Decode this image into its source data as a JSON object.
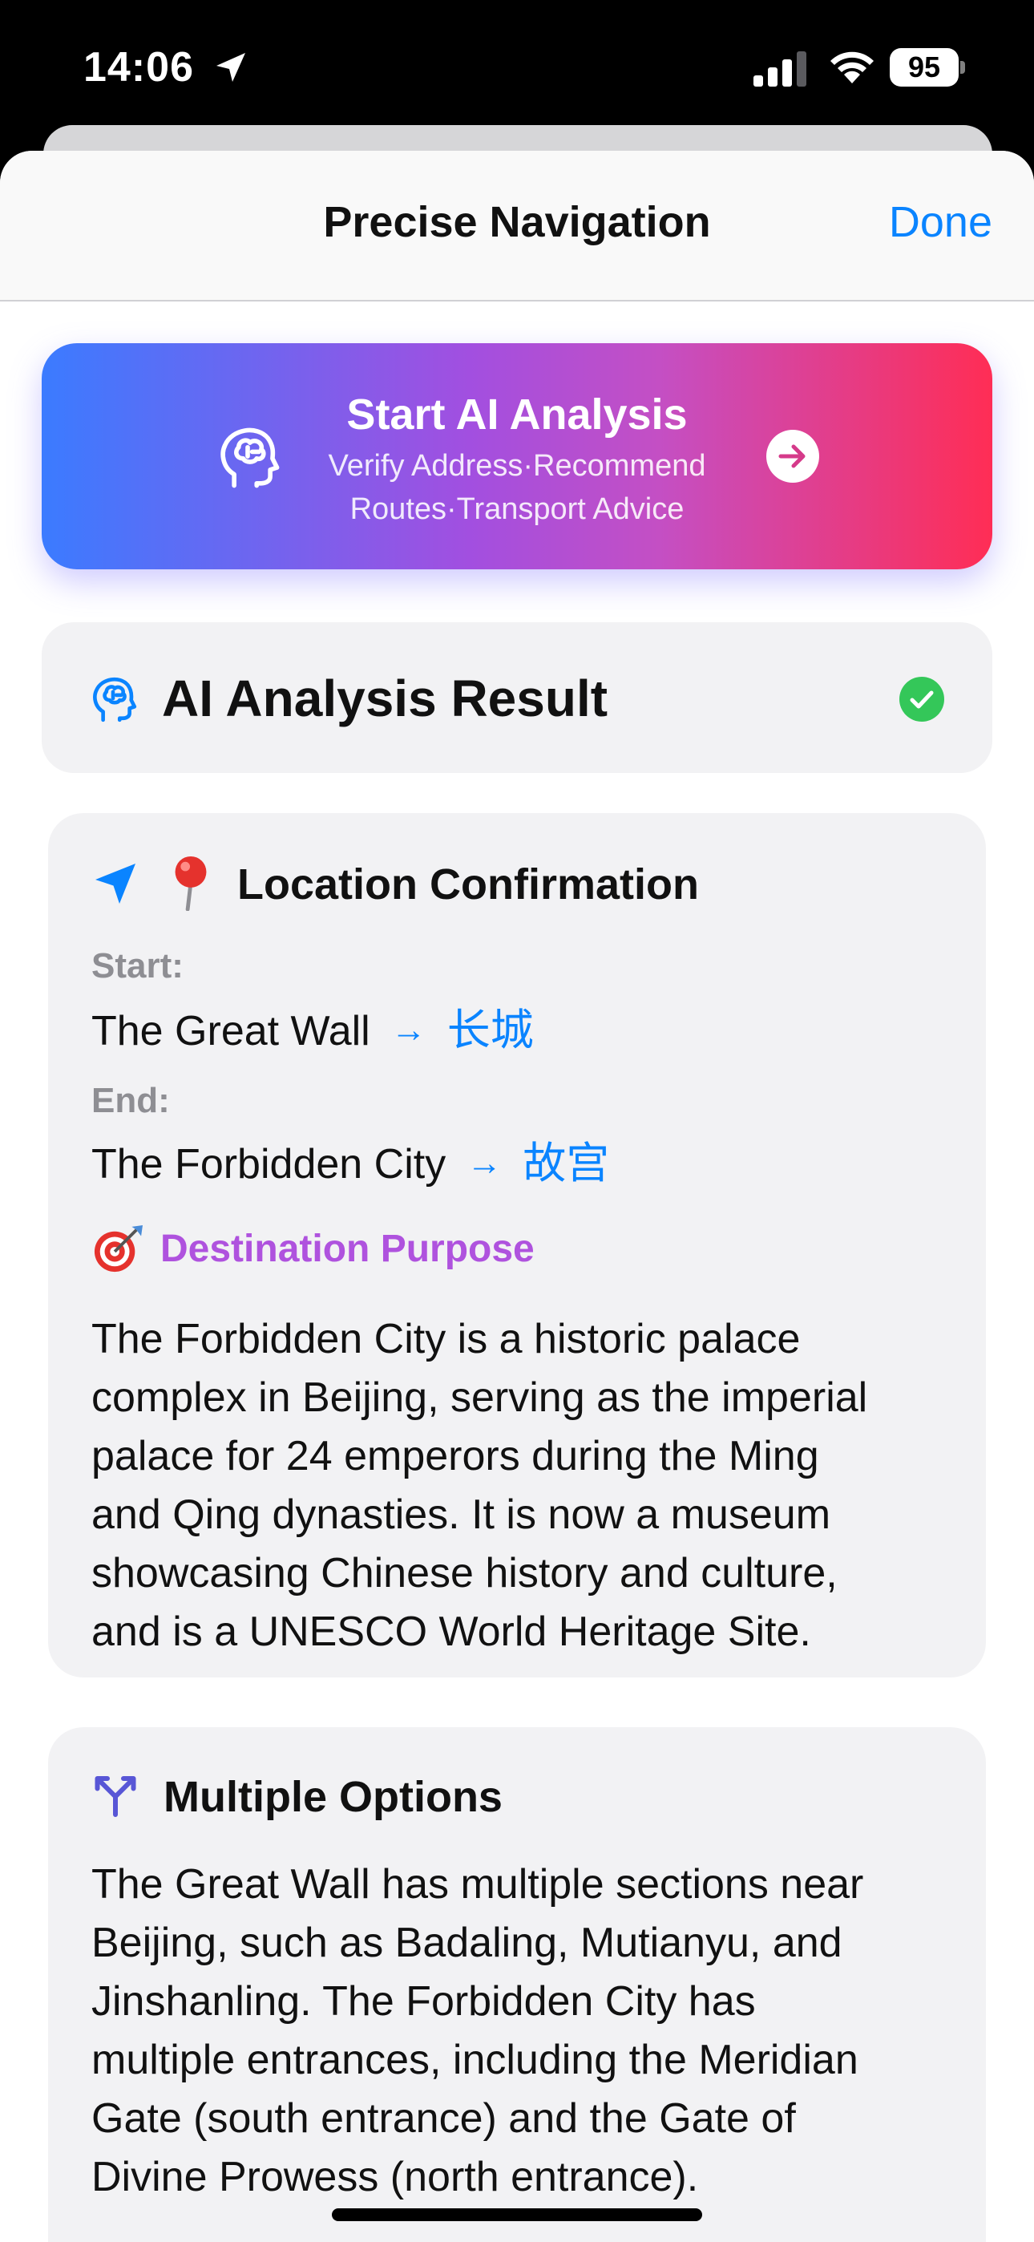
{
  "status": {
    "time": "14:06",
    "battery": "95"
  },
  "nav": {
    "title": "Precise Navigation",
    "done_label": "Done"
  },
  "ai_button": {
    "title": "Start AI Analysis",
    "subtitle_line1": "Verify Address·Recommend",
    "subtitle_line2": "Routes·Transport Advice"
  },
  "result": {
    "title": "AI Analysis Result"
  },
  "location_card": {
    "heading": "Location Confirmation",
    "start_label": "Start:",
    "start_name": "The Great Wall",
    "start_native": "长城",
    "end_label": "End:",
    "end_name": "The Forbidden City",
    "end_native": "故宫",
    "purpose_heading": "Destination Purpose",
    "purpose_lines": [
      "The Forbidden City is a historic palace",
      "complex in Beijing, serving as the imperial",
      "palace for 24 emperors during the Ming",
      "and Qing dynasties. It is now a museum",
      "showcasing Chinese history and culture,",
      "and is a UNESCO World Heritage Site."
    ]
  },
  "options_card": {
    "heading": "Multiple Options",
    "lines": [
      "The Great Wall has multiple sections near",
      "Beijing, such as Badaling, Mutianyu, and",
      "Jinshanling. The Forbidden City has",
      "multiple entrances, including the Meridian",
      "Gate (south entrance) and the Gate of",
      "Divine Prowess (north entrance)."
    ]
  },
  "colors": {
    "accent": "#0a84ff",
    "purple": "#af52de",
    "success": "#34c759",
    "gradient_start": "#3b7bff",
    "gradient_end": "#ff2d55"
  },
  "icons": {
    "status": [
      "location-arrow-icon",
      "signal-bars-icon",
      "wifi-icon",
      "battery-icon"
    ],
    "ai_button": [
      "brain-head-icon",
      "arrow-right-circle-icon"
    ],
    "result": [
      "brain-head-icon",
      "checkmark-circle-icon"
    ],
    "location_card": [
      "navigation-arrow-icon",
      "pushpin-emoji-icon",
      "target-emoji-icon"
    ],
    "options_card": [
      "branch-split-icon"
    ]
  }
}
